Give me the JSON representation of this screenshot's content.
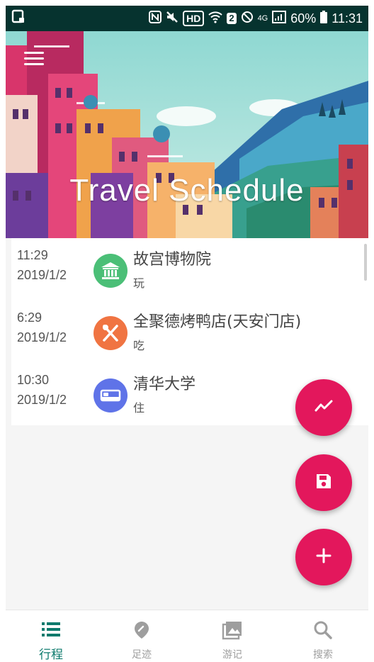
{
  "status_bar": {
    "left_icon": "notification-square-icon",
    "hd": "HD",
    "sim_slot": "2",
    "network": "4G",
    "battery": "60%",
    "time": "11:31"
  },
  "header": {
    "title": "Travel Schedule",
    "menu_icon": "hamburger-menu-icon"
  },
  "trips": [
    {
      "time": "11:29",
      "date": "2019/1/2",
      "name": "故宫博物院",
      "type": "玩",
      "icon": "museum-icon",
      "icon_color": "#4bbf77"
    },
    {
      "time": "6:29",
      "date": "2019/1/2",
      "name": "全聚德烤鸭店(天安门店)",
      "type": "吃",
      "icon": "utensils-icon",
      "icon_color": "#f07442"
    },
    {
      "time": "10:30",
      "date": "2019/1/2",
      "name": "清华大学",
      "type": "住",
      "icon": "bed-icon",
      "icon_color": "#5f73e8"
    }
  ],
  "fabs": {
    "stats_icon": "trend-line-icon",
    "save_icon": "save-icon",
    "add_icon": "plus-icon",
    "color": "#e3175c"
  },
  "bottom_nav": {
    "active_color": "#0c7a6c",
    "items": [
      {
        "label": "行程",
        "icon": "list-icon",
        "active": true
      },
      {
        "label": "足迹",
        "icon": "location-pin-icon",
        "active": false
      },
      {
        "label": "游记",
        "icon": "photo-icon",
        "active": false
      },
      {
        "label": "搜索",
        "icon": "search-icon",
        "active": false
      }
    ]
  }
}
